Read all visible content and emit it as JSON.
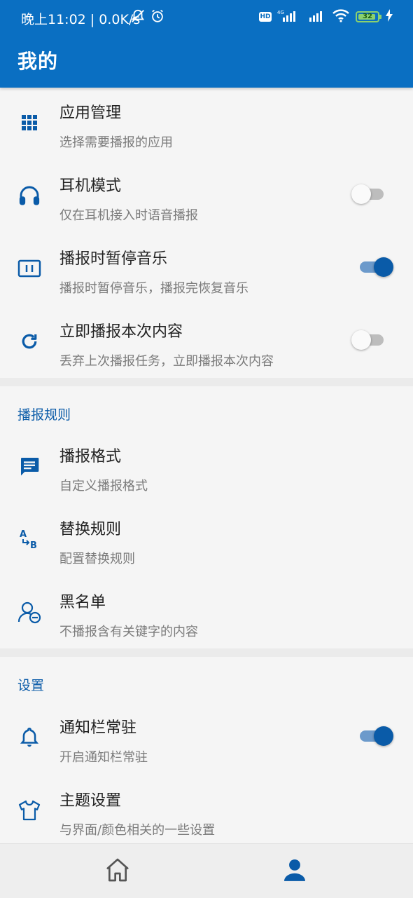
{
  "status_bar": {
    "time": "晚上11:02 | 0.0K/s",
    "hd": "HD",
    "battery": "32"
  },
  "header": {
    "title": "我的"
  },
  "general": {
    "items": [
      {
        "title": "应用管理",
        "subtitle": "选择需要播报的应用",
        "icon": "grid-icon"
      },
      {
        "title": "耳机模式",
        "subtitle": "仅在耳机接入时语音播报",
        "icon": "headphones-icon",
        "toggle": false
      },
      {
        "title": "播报时暂停音乐",
        "subtitle": "播报时暂停音乐，播报完恢复音乐",
        "icon": "pause-icon",
        "toggle": true
      },
      {
        "title": "立即播报本次内容",
        "subtitle": "丢弃上次播报任务，立即播报本次内容",
        "icon": "refresh-icon",
        "toggle": false
      }
    ]
  },
  "rules": {
    "header": "播报规则",
    "items": [
      {
        "title": "播报格式",
        "subtitle": "自定义播报格式",
        "icon": "message-icon"
      },
      {
        "title": "替换规则",
        "subtitle": "配置替换规则",
        "icon": "swap-ab-icon"
      },
      {
        "title": "黑名单",
        "subtitle": "不播报含有关键字的内容",
        "icon": "user-blocked-icon"
      }
    ]
  },
  "settings": {
    "header": "设置",
    "items": [
      {
        "title": "通知栏常驻",
        "subtitle": "开启通知栏常驻",
        "icon": "bell-icon",
        "toggle": true
      },
      {
        "title": "主题设置",
        "subtitle": "与界面/颜色相关的一些设置",
        "icon": "shirt-icon"
      }
    ]
  },
  "bottom_nav": {
    "items": [
      {
        "icon": "home-icon",
        "active": false
      },
      {
        "icon": "person-icon",
        "active": true
      }
    ]
  },
  "colors": {
    "primary": "#0a6fc2",
    "accent": "#0a5ba8",
    "background": "#f5f5f5"
  }
}
